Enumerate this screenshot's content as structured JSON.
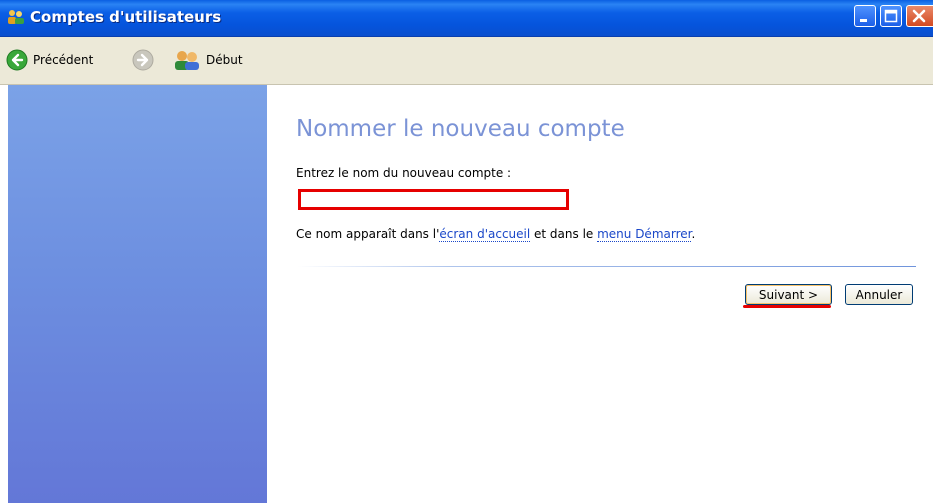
{
  "window": {
    "title": "Comptes d'utilisateurs",
    "controls": [
      "minimize-icon",
      "maximize-icon",
      "close-icon"
    ]
  },
  "toolbar": {
    "back_label": "Précédent",
    "forward_label": "",
    "home_label": "Début"
  },
  "main": {
    "heading": "Nommer le nouveau compte",
    "prompt": "Entrez le nom du nouveau compte :",
    "account_name_value": "",
    "hint_prefix": "Ce nom apparaît dans l'",
    "hint_link1": "écran d'accueil",
    "hint_middle": " et dans le ",
    "hint_link2": "menu Démarrer",
    "hint_suffix": ".",
    "next_button": "Suivant >",
    "cancel_button": "Annuler"
  },
  "colors": {
    "titlebar": "#0554dc",
    "sidepane": "#6d8fe0",
    "heading": "#7b93d6",
    "highlight": "#e60000",
    "link": "#1a47c8"
  }
}
